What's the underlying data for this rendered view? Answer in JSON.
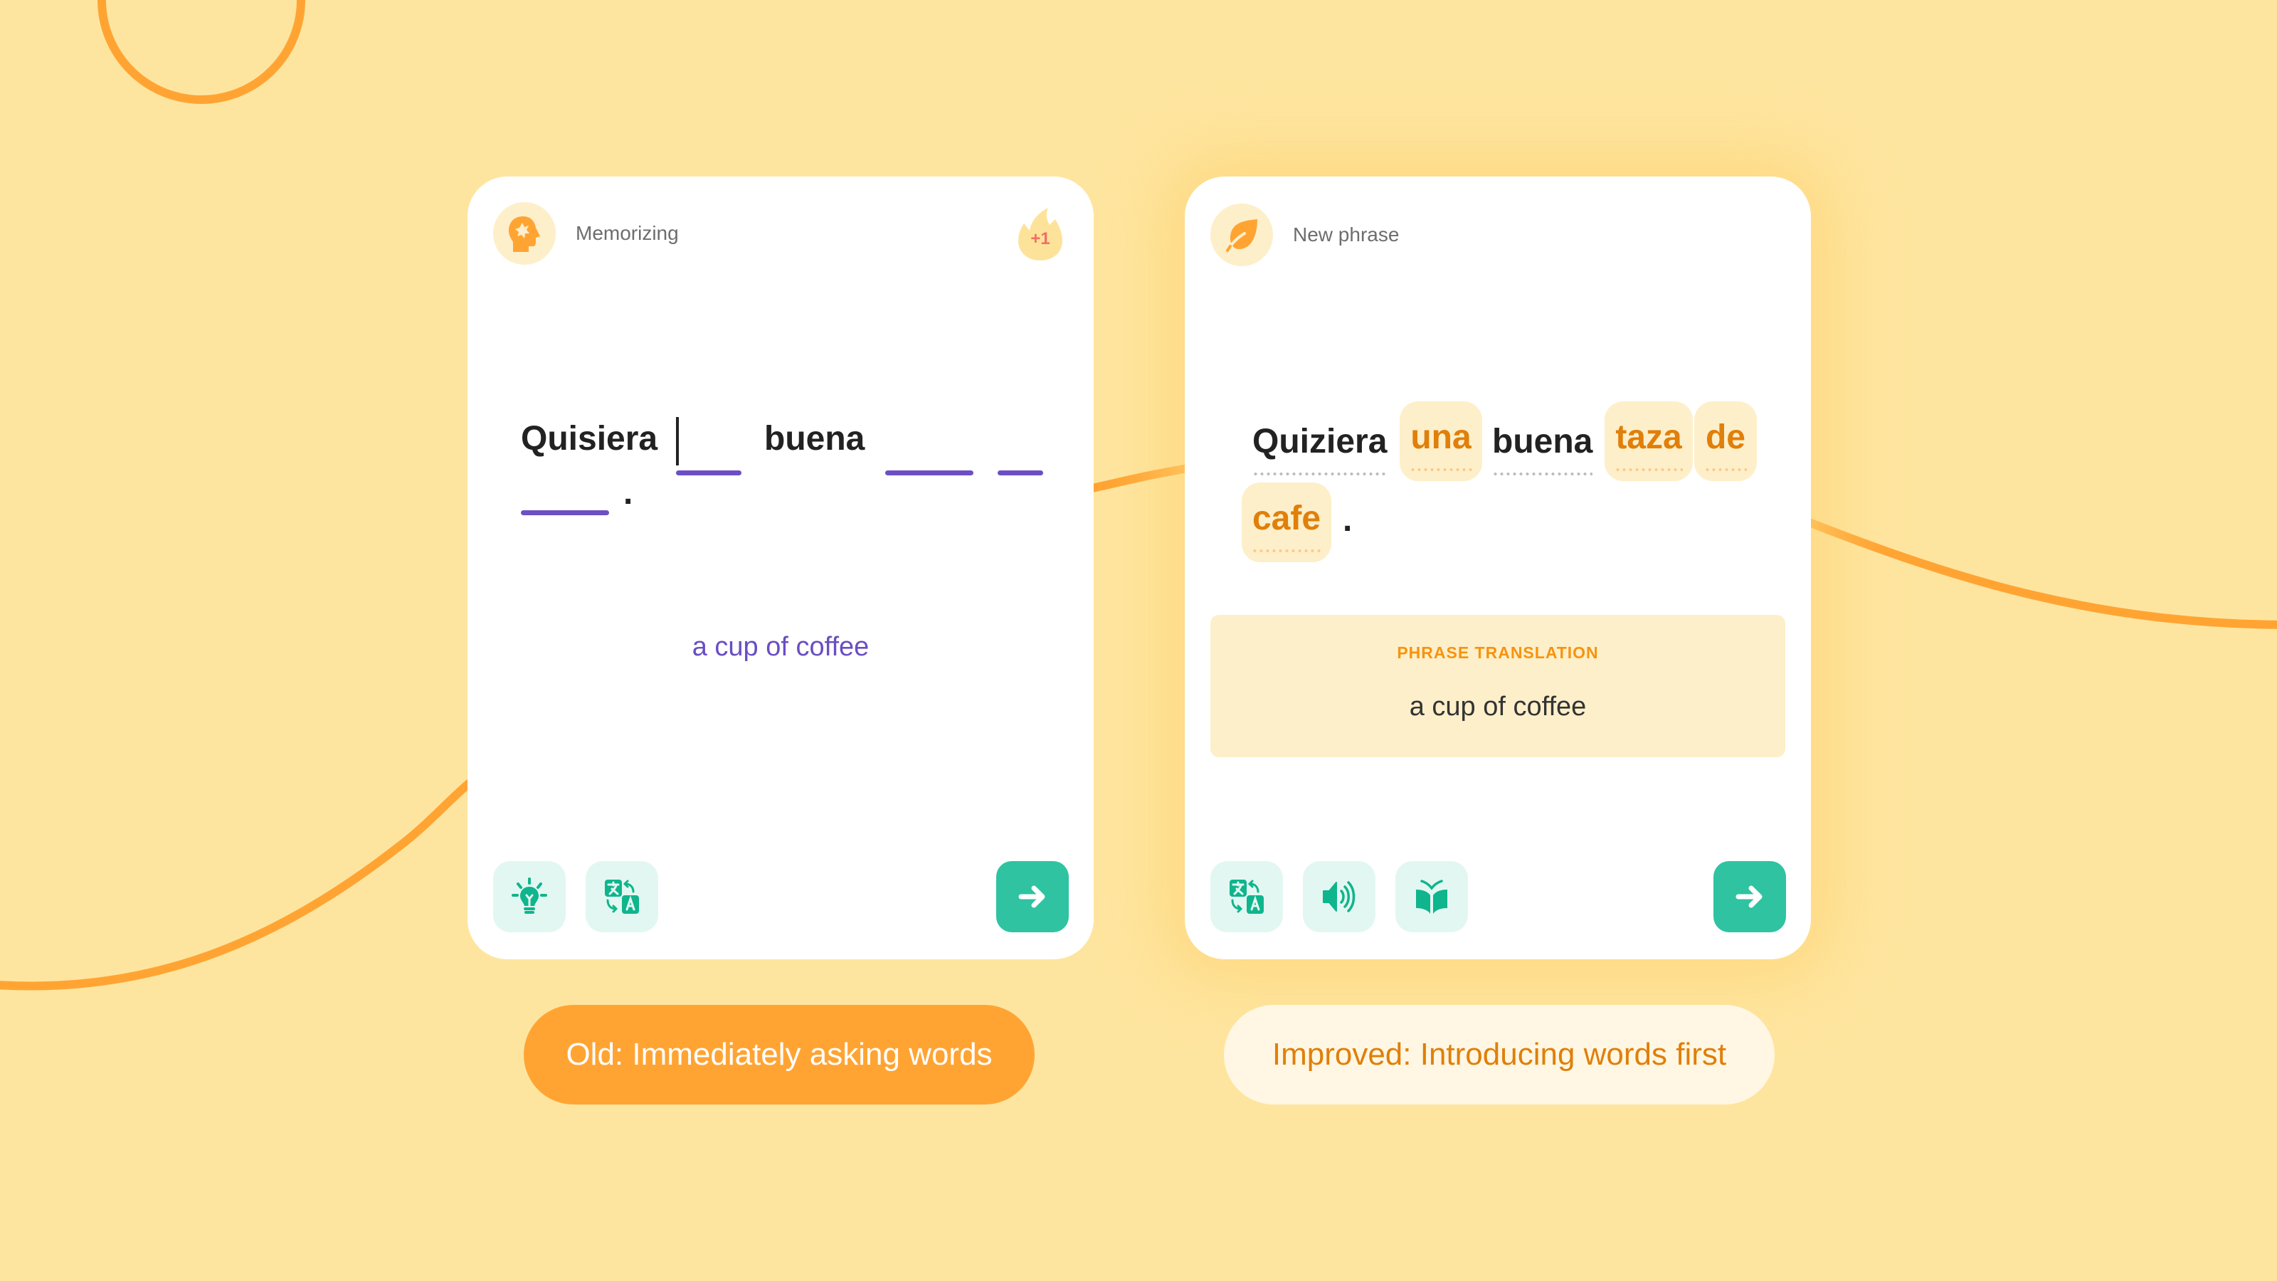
{
  "colors": {
    "background": "#fee59f",
    "accent_orange": "#ffa433",
    "chip_text": "#e07f0a",
    "chip_bg": "#fdefc9",
    "blank_purple": "#6c4fc4",
    "teal_button": "#2fc3a2",
    "teal_icon": "#0fb58c",
    "tool_bg": "#e3f7f2",
    "streak_text": "#f26e62"
  },
  "old_card": {
    "mode_icon": "head-gear-icon",
    "mode_label": "Memorizing",
    "streak_badge": "+1",
    "sentence": {
      "word_1": "Quisiera",
      "word_2": "buena",
      "punctuation": ".",
      "blank_count": 4
    },
    "hint": "a cup of coffee",
    "tools": [
      {
        "icon": "lightbulb-icon",
        "label": "Hint"
      },
      {
        "icon": "translate-icon",
        "label": "Translate"
      }
    ],
    "next_icon": "arrow-right-icon"
  },
  "new_card": {
    "mode_icon": "leaf-icon",
    "mode_label": "New phrase",
    "sentence": {
      "words": [
        {
          "text": "Quiziera",
          "new": false
        },
        {
          "text": "una",
          "new": true
        },
        {
          "text": "buena",
          "new": false
        },
        {
          "text": "taza",
          "new": true
        },
        {
          "text": "de",
          "new": true
        },
        {
          "text": "cafe",
          "new": true
        }
      ],
      "punctuation": "."
    },
    "translation_label": "PHRASE TRANSLATION",
    "translation_text": "a cup of coffee",
    "tools": [
      {
        "icon": "translate-icon",
        "label": "Translate"
      },
      {
        "icon": "speaker-icon",
        "label": "Audio"
      },
      {
        "icon": "book-icon",
        "label": "Dictionary"
      }
    ],
    "next_icon": "arrow-right-icon"
  },
  "captions": {
    "old": "Old: Immediately asking words",
    "improved": "Improved: Introducing words first"
  }
}
